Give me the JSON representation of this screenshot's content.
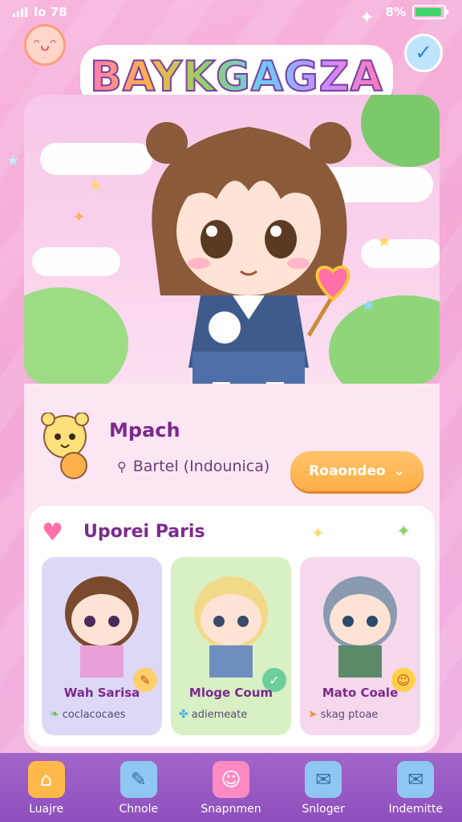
{
  "status_bar": {
    "time": "lo 78",
    "battery_text": "8%"
  },
  "app": {
    "logo_text": "BAYKGAGZA"
  },
  "profile": {
    "name": "Mpach",
    "subtitle": "Bartel (Indounica)",
    "recommend_label": "Roaondeo"
  },
  "updates": {
    "title": "Uporei Paris",
    "cards": [
      {
        "name": "Wah Sarisa",
        "tag": "coclacocaes"
      },
      {
        "name": "Mloge Coum",
        "tag": "adiemeate"
      },
      {
        "name": "Mato Coale",
        "tag": "skag ptoae"
      }
    ]
  },
  "bottom_nav": [
    {
      "label": "Luajre",
      "icon": "home-icon"
    },
    {
      "label": "Chnole",
      "icon": "chat-edit-icon"
    },
    {
      "label": "Snapnmen",
      "icon": "gift-box-icon"
    },
    {
      "label": "Snloger",
      "icon": "mail-icon"
    },
    {
      "label": "Indemitte",
      "icon": "mailbox-icon"
    }
  ],
  "colors": {
    "accent_purple": "#8e4fbd",
    "button_orange": "#ffae45",
    "title_purple": "#7b2a8c",
    "background_pink": "#f4a9d7"
  }
}
